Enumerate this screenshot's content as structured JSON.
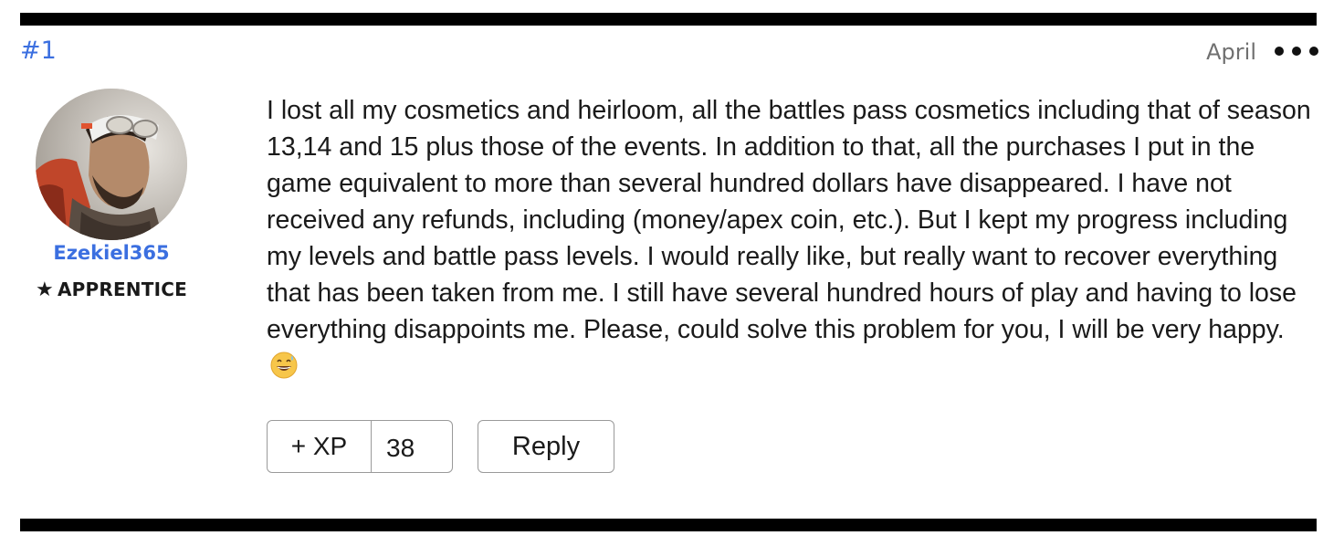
{
  "post": {
    "number": "#1",
    "date": "April",
    "more_icon": "more-horizontal-icon"
  },
  "author": {
    "username": "Ezekiel365",
    "rank_icon": "star-icon",
    "rank_star": "★",
    "rank": "APPRENTICE"
  },
  "content": {
    "text": "I lost all my cosmetics and heirloom, all the battles pass cosmetics including that of season 13,14 and 15 plus those of the events. In addition to that, all the purchases I put in the game equivalent to more than several hundred dollars have disappeared. I have not received any refunds, including (money/apex coin, etc.). But I kept my progress including my levels and battle pass levels. I would really like, but really want to recover everything that has been taken from me. I still have several hundred hours of play and having to lose everything disappoints me. Please, could solve this problem for you, I will be very happy.",
    "emoji": "grinning-face-with-sweat-emoji"
  },
  "actions": {
    "xp_label": "+ XP",
    "xp_count": "38",
    "reply_label": "Reply"
  },
  "colors": {
    "link": "#3b6fe0",
    "separator": "#000000",
    "border": "#9a9a9a"
  }
}
